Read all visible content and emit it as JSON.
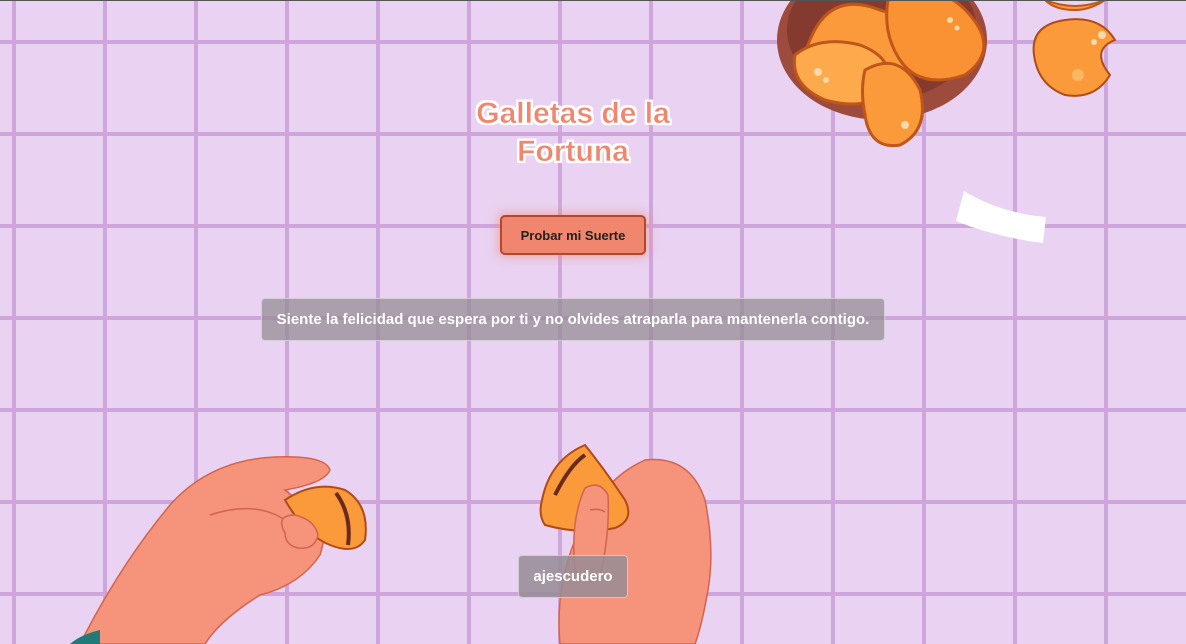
{
  "title": {
    "line1": "Galletas de la",
    "line2": "Fortuna"
  },
  "button": {
    "label": "Probar mi Suerte"
  },
  "message": {
    "text": "Siente la felicidad que espera por ti y no olvides atraparla para mantenerla contigo."
  },
  "footer": {
    "author": "ajescudero"
  },
  "colors": {
    "background": "#e9d2f2",
    "grid_lines": "#cfa6dc",
    "accent": "#f1866e",
    "cookie": "#fb9a3a",
    "bowl": "#9d4b3c",
    "skin": "#f5937b"
  }
}
